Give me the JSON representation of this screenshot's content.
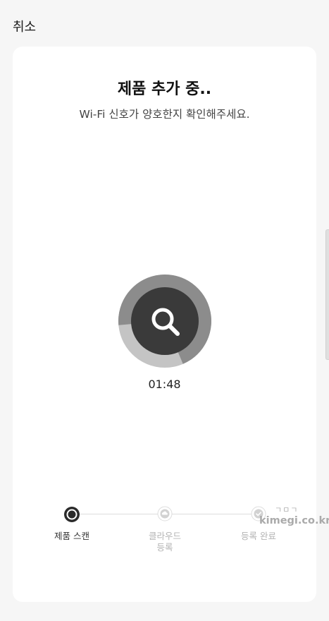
{
  "header": {
    "cancel_label": "취소"
  },
  "main": {
    "title": "제품 추가 중..",
    "subtitle": "Wi-Fi 신호가 양호한지 확인해주세요.",
    "timer": "01:48",
    "scan_progress_fraction": 0.3
  },
  "steps": [
    {
      "label": "제품 스캔",
      "state": "active"
    },
    {
      "label": "클라우드\n등록",
      "state": "inactive"
    },
    {
      "label": "등록 완료",
      "state": "inactive"
    }
  ],
  "watermark": {
    "logo": "ㄱㅁㄱ",
    "text": "kimegi.co.kr"
  },
  "colors": {
    "background": "#f6f6f6",
    "card": "#ffffff",
    "scan_outer": "#c4c4c4",
    "scan_progress": "#8c8c8c",
    "scan_inner": "#3a3a3a",
    "inactive": "#b4b4b4"
  }
}
